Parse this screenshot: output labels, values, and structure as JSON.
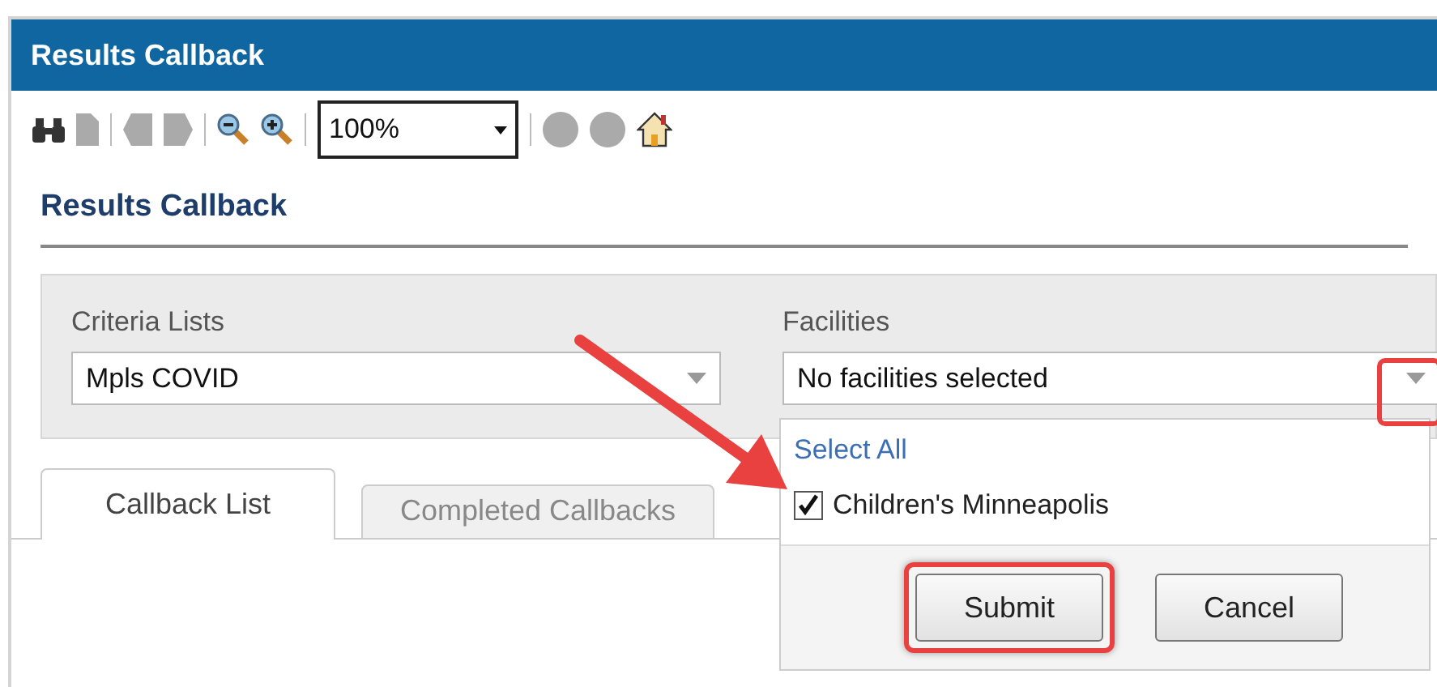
{
  "window": {
    "title": "Results Callback"
  },
  "toolbar": {
    "zoom": "100%"
  },
  "heading": "Results Callback",
  "criteria": {
    "label": "Criteria Lists",
    "value": "Mpls COVID"
  },
  "facilities": {
    "label": "Facilities",
    "value": "No facilities selected",
    "expanded": true
  },
  "dropdown": {
    "select_all": "Select All",
    "options": [
      {
        "label": "Children's Minneapolis",
        "checked": true
      }
    ],
    "buttons": [
      {
        "label": "Submit",
        "highlighted": true
      },
      {
        "label": "Cancel",
        "highlighted": false
      }
    ]
  },
  "tabs": [
    {
      "label": "Callback List",
      "selected": true
    },
    {
      "label": "Completed Callbacks",
      "selected": false
    }
  ]
}
